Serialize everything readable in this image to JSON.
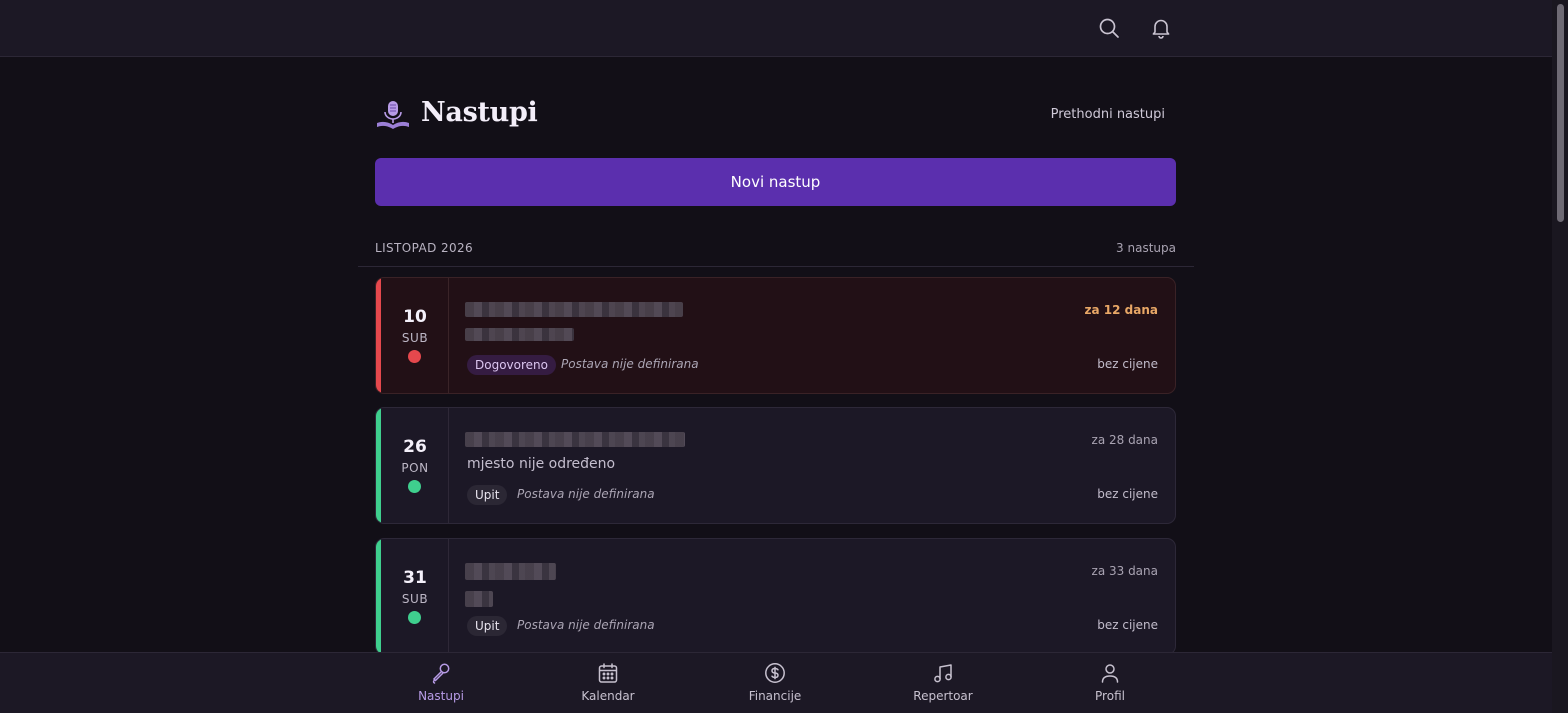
{
  "header": {
    "title": "Nastupi",
    "prev_link": "Prethodni nastupi",
    "new_button": "Novi nastup"
  },
  "month": {
    "label": "LISTOPAD 2026",
    "count": "3 nastupa"
  },
  "gigs": [
    {
      "day": "10",
      "dow": "SUB",
      "status_color": "#e5484d",
      "accent": "#e5484d",
      "when": "za 12 dana",
      "badge": "Dogovoreno",
      "setlist": "Postava nije definirana",
      "price": "bez cijene",
      "place": ""
    },
    {
      "day": "26",
      "dow": "PON",
      "status_color": "#3fcf8e",
      "accent": "#3fcf8e",
      "when": "za 28 dana",
      "badge": "Upit",
      "setlist": "Postava nije definirana",
      "price": "bez cijene",
      "place": "mjesto nije određeno"
    },
    {
      "day": "31",
      "dow": "SUB",
      "status_color": "#3fcf8e",
      "accent": "#3fcf8e",
      "when": "za 33 dana",
      "badge": "Upit",
      "setlist": "Postava nije definirana",
      "price": "bez cijene",
      "place": ""
    }
  ],
  "nav": [
    {
      "label": "Nastupi",
      "icon": "microphone-icon",
      "active": true
    },
    {
      "label": "Kalendar",
      "icon": "calendar-icon",
      "active": false
    },
    {
      "label": "Financije",
      "icon": "dollar-circle-icon",
      "active": false
    },
    {
      "label": "Repertoar",
      "icon": "music-note-icon",
      "active": false
    },
    {
      "label": "Profil",
      "icon": "user-icon",
      "active": false
    }
  ],
  "colors": {
    "accent": "#5b2fae",
    "active_nav": "#b79be6"
  }
}
